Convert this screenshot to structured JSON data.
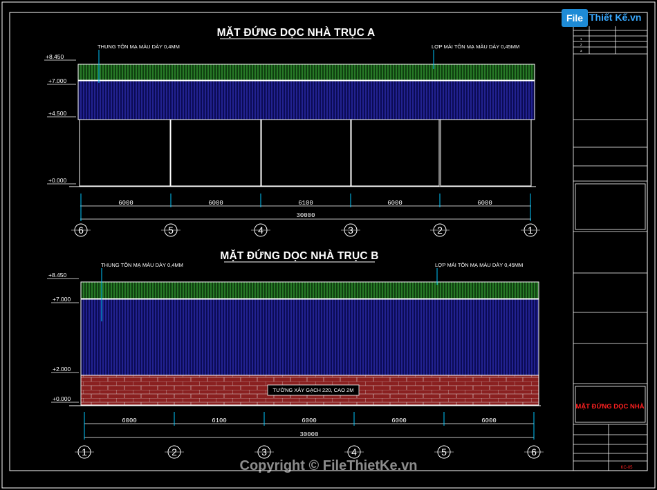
{
  "titles": {
    "top": "MẶT ĐỨNG DỌC NHÀ TRỤC A",
    "bottom": "MẶT ĐỨNG DỌC NHÀ TRỤC B"
  },
  "notes": {
    "wall_sheet": "THUNG TÔN MẠ MÀU DÀY 0,4MM",
    "roof_sheet": "LỢP MÁI TÔN MẠ MÀU DÀY 0,45MM",
    "brick_wall": "TƯỜNG XÂY GẠCH 220, CAO 2M"
  },
  "levels_top": [
    "+8.450",
    "+7.000",
    "+4.500",
    "+0.000"
  ],
  "levels_bottom": [
    "+8.450",
    "+7.000",
    "+2.000",
    "+0.000"
  ],
  "dims_top": [
    "6000",
    "6000",
    "6100",
    "6000",
    "6000"
  ],
  "dims_top_total": "30000",
  "dims_bottom": [
    "6000",
    "6100",
    "6000",
    "6000",
    "6000"
  ],
  "dims_bottom_total": "30000",
  "axes_top": [
    "6",
    "5",
    "4",
    "3",
    "2",
    "1"
  ],
  "axes_bottom": [
    "1",
    "2",
    "3",
    "4",
    "5",
    "6"
  ],
  "title_block": {
    "rows": [
      "1",
      "2",
      "3"
    ],
    "sheet_title": "MẶT ĐỨNG DỌC NHÀ",
    "sheet_code": "KC-05"
  },
  "logo": {
    "part1": "File",
    "part2": "Thiết Kế.vn"
  },
  "watermark": "Copyright © FileThietKe.vn",
  "colors": {
    "roof_green": "#1f7a1f",
    "wall_blue": "#1a1a8c",
    "brick_red": "#8a2020",
    "line_white": "#ffffff",
    "dim_cyan": "#00c8ff",
    "title_red": "#ff2020"
  }
}
